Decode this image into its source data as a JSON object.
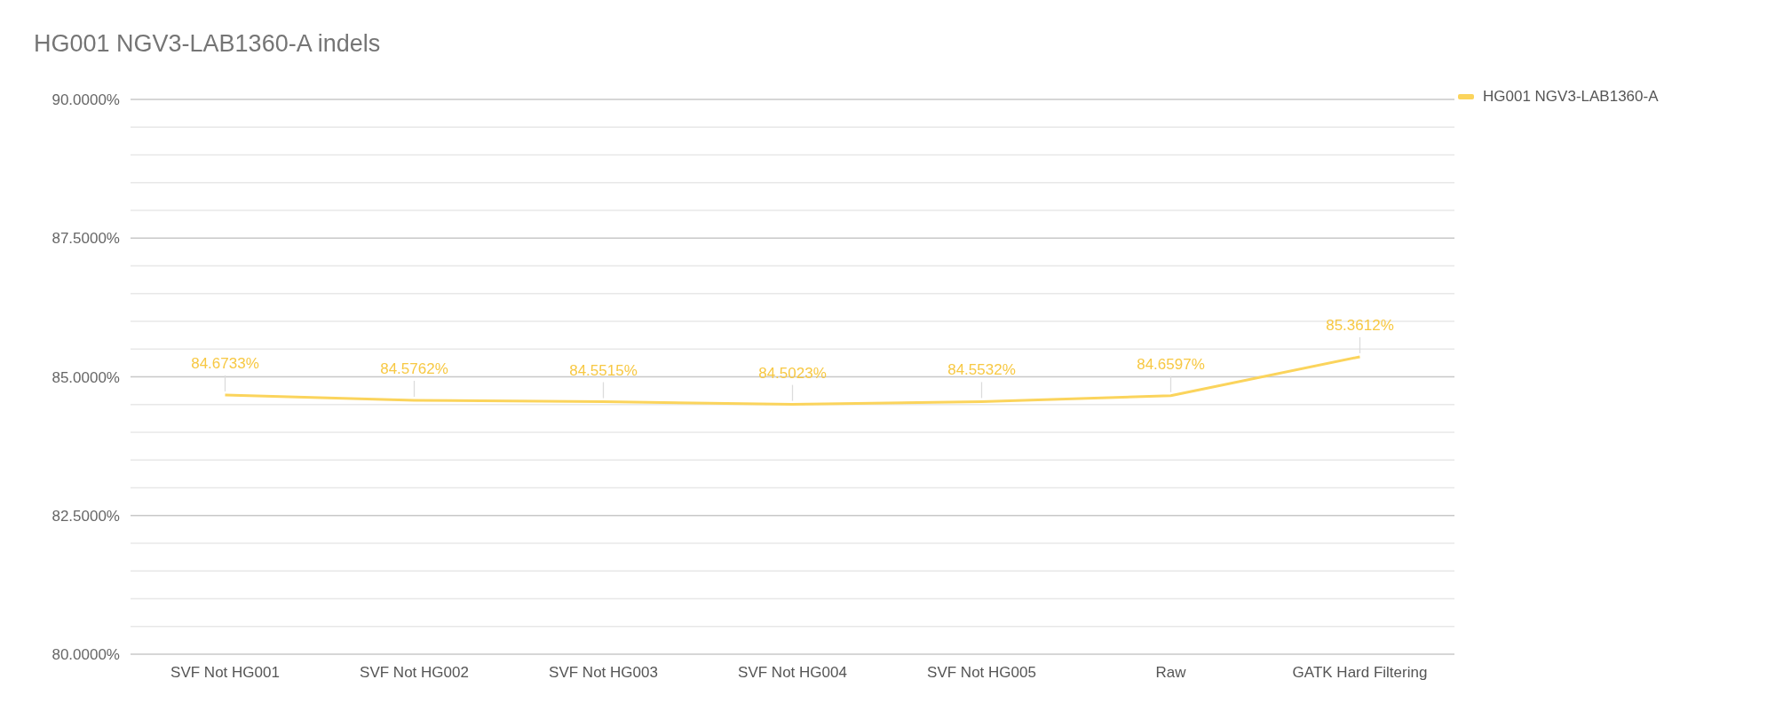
{
  "chart_data": {
    "type": "line",
    "title": "HG001 NGV3-LAB1360-A indels",
    "categories": [
      "SVF Not HG001",
      "SVF Not HG002",
      "SVF Not HG003",
      "SVF Not HG004",
      "SVF Not HG005",
      "Raw",
      "GATK Hard Filtering"
    ],
    "series": [
      {
        "name": "HG001 NGV3-LAB1360-A",
        "color": "#fbd45c",
        "values": [
          84.6733,
          84.5762,
          84.5515,
          84.5023,
          84.5532,
          84.6597,
          85.3612
        ]
      }
    ],
    "value_labels": [
      "84.6733%",
      "84.5762%",
      "84.5515%",
      "84.5023%",
      "84.5532%",
      "84.6597%",
      "85.3612%"
    ],
    "ylim": [
      80,
      90
    ],
    "yticks": [
      {
        "value": 80,
        "label": "80.0000%"
      },
      {
        "value": 82.5,
        "label": "82.5000%"
      },
      {
        "value": 85,
        "label": "85.0000%"
      },
      {
        "value": 87.5,
        "label": "87.5000%"
      },
      {
        "value": 90,
        "label": "90.0000%"
      }
    ],
    "grid": true
  }
}
